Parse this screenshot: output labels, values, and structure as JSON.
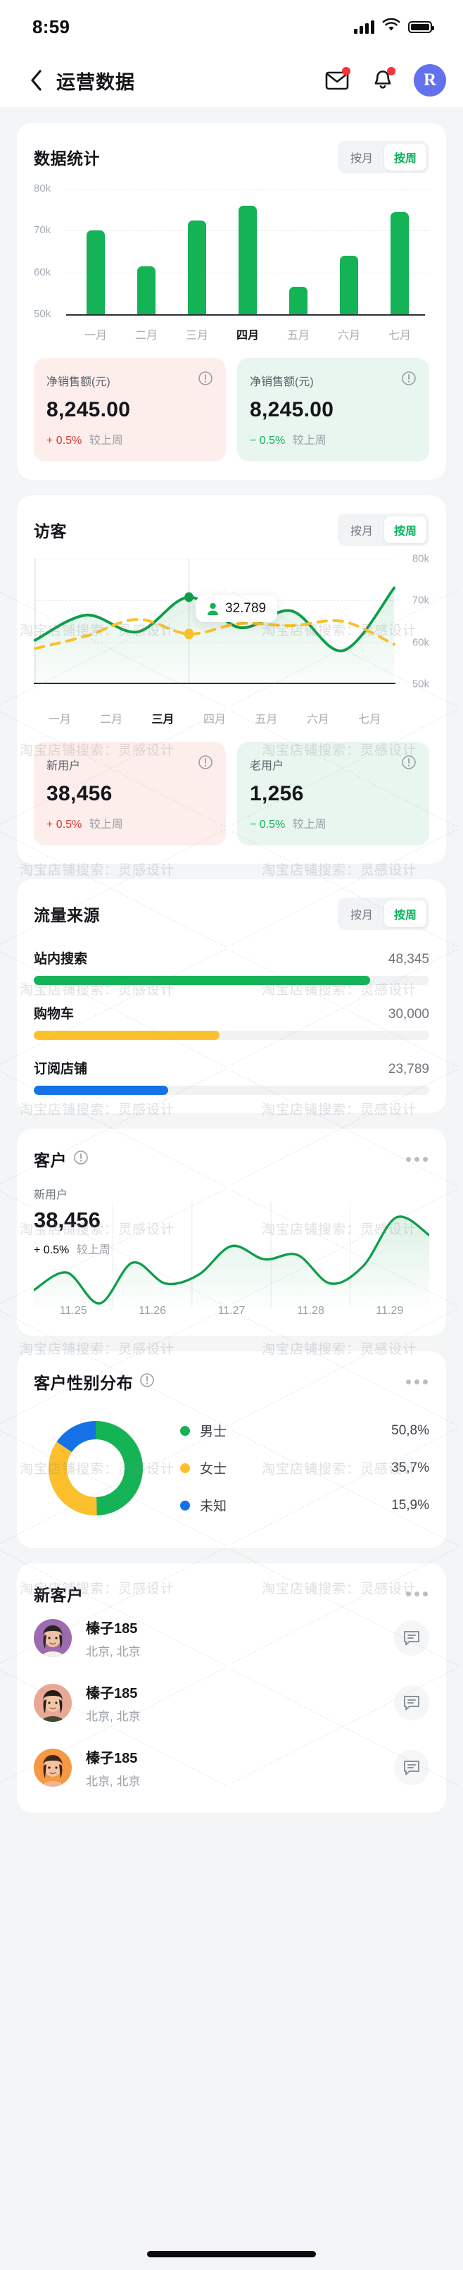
{
  "status_bar": {
    "time": "8:59",
    "signal_icon": "cellular-signal-icon",
    "wifi_icon": "wifi-icon",
    "battery_icon": "battery-icon"
  },
  "nav": {
    "back_icon": "chevron-left-icon",
    "title": "运营数据",
    "mail_icon": "mail-icon",
    "bell_icon": "bell-icon",
    "avatar_letter": "R"
  },
  "watermark": {
    "text": "淘宝店铺搜索：灵感设计"
  },
  "colors": {
    "green": "#14b356",
    "green_dark": "#0e9e4a",
    "yellow": "#fbc02b",
    "blue": "#1472e6",
    "red": "#e0352b",
    "track": "#f0f2f4",
    "accent_brand": "#6272ee"
  },
  "segment": {
    "month": "按月",
    "week": "按周",
    "selected": "按周"
  },
  "stats_card": {
    "title": "数据统计",
    "stats": [
      {
        "label": "净销售额(元)",
        "value": "8,245.00",
        "delta": "+ 0.5%",
        "delta_dir": "up",
        "compare": "较上周",
        "info_icon": "info-icon"
      },
      {
        "label": "净销售额(元)",
        "value": "8,245.00",
        "delta": "− 0.5%",
        "delta_dir": "down",
        "compare": "较上周",
        "info_icon": "info-icon"
      }
    ]
  },
  "visitors_card": {
    "title": "访客",
    "tooltip": {
      "value": "32.789",
      "icon": "person-icon"
    },
    "stats": [
      {
        "label": "新用户",
        "value": "38,456",
        "delta": "+ 0.5%",
        "delta_dir": "up",
        "compare": "较上周",
        "info_icon": "info-icon"
      },
      {
        "label": "老用户",
        "value": "1,256",
        "delta": "− 0.5%",
        "delta_dir": "down",
        "compare": "较上周",
        "info_icon": "info-icon"
      }
    ]
  },
  "traffic_card": {
    "title": "流量来源",
    "rows": [
      {
        "name": "站内搜索",
        "value": "48,345",
        "pct": 85,
        "color": "#14b356"
      },
      {
        "name": "购物车",
        "value": "30,000",
        "pct": 47,
        "color": "#fbc02b"
      },
      {
        "name": "订阅店铺",
        "value": "23,789",
        "pct": 34,
        "color": "#1472e6"
      }
    ]
  },
  "customer_card": {
    "title": "客户",
    "info_icon": "info-icon",
    "more_icon": "more-horizontal-icon",
    "label": "新用户",
    "value": "38,456",
    "delta": "+ 0.5%",
    "delta_dir": "up",
    "compare": "较上周"
  },
  "gender_card": {
    "title": "客户性别分布",
    "info_icon": "info-icon",
    "more_icon": "more-horizontal-icon"
  },
  "new_customers_card": {
    "title": "新客户",
    "more_icon": "more-horizontal-icon",
    "people": [
      {
        "name": "榛子185",
        "location": "北京, 北京",
        "chat_icon": "chat-icon",
        "avatar_bg": "#9c6bb0",
        "hair": "#2a2220",
        "skin": "#f0c3a6",
        "cloth": "#f3f0ea"
      },
      {
        "name": "榛子185",
        "location": "北京, 北京",
        "chat_icon": "chat-icon",
        "avatar_bg": "#e8a894",
        "hair": "#221c1a",
        "skin": "#f3c6a8",
        "cloth": "#3f4a32"
      },
      {
        "name": "榛子185",
        "location": "北京, 北京",
        "chat_icon": "chat-icon",
        "avatar_bg": "#f79842",
        "hair": "#3a2518",
        "skin": "#f5c39f",
        "cloth": "#f0b49a"
      }
    ]
  },
  "chart_data": [
    {
      "type": "bar",
      "title": "数据统计",
      "categories": [
        "一月",
        "二月",
        "三月",
        "四月",
        "五月",
        "六月",
        "七月"
      ],
      "values": [
        70000,
        61500,
        72500,
        76000,
        56500,
        64000,
        74500
      ],
      "highlight_category": "四月",
      "ylabel": "",
      "xlabel": "",
      "ylim": [
        50000,
        80000
      ],
      "ytick_labels": [
        "80k",
        "70k",
        "60k",
        "50k"
      ],
      "grid": true,
      "legend": "none",
      "bar_color": "#14b356"
    },
    {
      "type": "line",
      "title": "访客",
      "x": [
        "一月",
        "二月",
        "三月",
        "四月",
        "五月",
        "六月",
        "七月"
      ],
      "highlight_category": "三月",
      "ylim": [
        50000,
        80000
      ],
      "ytick_labels": [
        "80k",
        "70k",
        "60k",
        "50k"
      ],
      "ytick_position": "right",
      "grid": true,
      "annotation": "32.789",
      "series": [
        {
          "name": "新用户",
          "style": "solid",
          "color": "#0e9e4a",
          "values": [
            60500,
            66500,
            62500,
            70800,
            63500,
            67500,
            58000,
            73000
          ]
        },
        {
          "name": "老用户",
          "style": "dashed",
          "color": "#fbc02b",
          "values": [
            58500,
            61500,
            65500,
            62000,
            64500,
            64000,
            65000,
            59500
          ]
        }
      ]
    },
    {
      "type": "bar",
      "title": "流量来源",
      "orientation": "horizontal",
      "categories": [
        "站内搜索",
        "购物车",
        "订阅店铺"
      ],
      "values": [
        48345,
        30000,
        23789
      ],
      "percent_of_track": [
        85,
        47,
        34
      ],
      "colors": [
        "#14b356",
        "#fbc02b",
        "#1472e6"
      ]
    },
    {
      "type": "area",
      "title": "客户",
      "xlabel": "",
      "tick_labels": [
        "11.25",
        "11.26",
        "11.27",
        "11.28",
        "11.29"
      ],
      "color": "#0e9e4a",
      "values": [
        30,
        46,
        18,
        55,
        36,
        44,
        70,
        58,
        62,
        36,
        52,
        96,
        80
      ]
    },
    {
      "type": "pie",
      "title": "客户性别分布",
      "variant": "donut",
      "labels": [
        "男士",
        "女士",
        "未知"
      ],
      "values": [
        50.8,
        35.7,
        15.9
      ],
      "value_labels": [
        "50,8%",
        "35,7%",
        "15,9%"
      ],
      "colors": [
        "#14b356",
        "#fbc02b",
        "#1472e6"
      ],
      "legend": "right"
    }
  ]
}
